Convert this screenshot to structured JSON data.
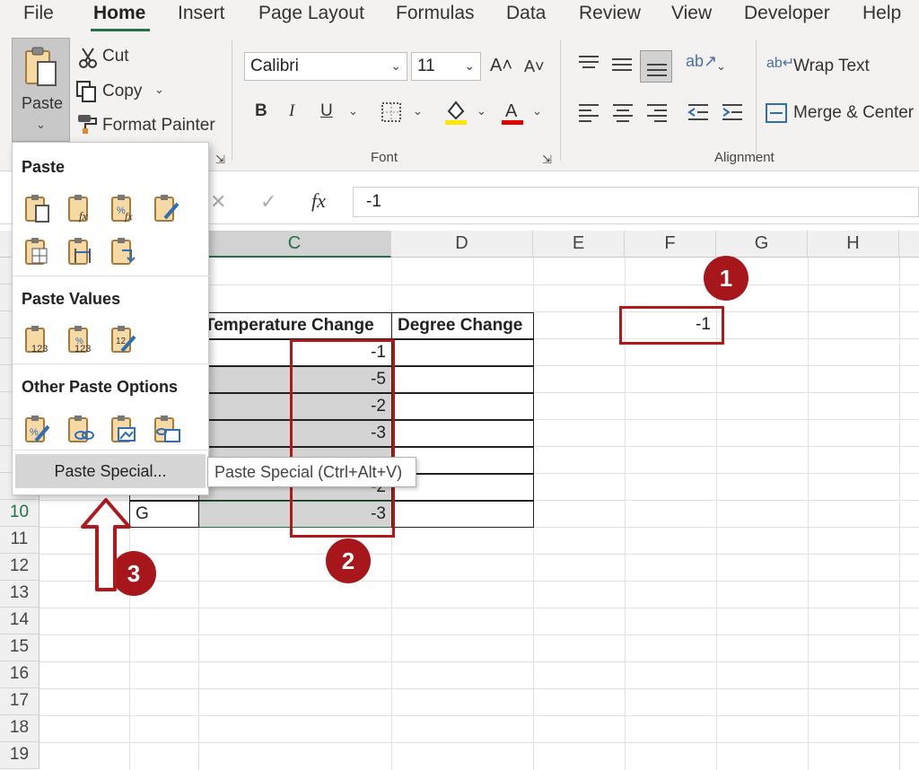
{
  "menu": {
    "tabs": [
      "File",
      "Home",
      "Insert",
      "Page Layout",
      "Formulas",
      "Data",
      "Review",
      "View",
      "Developer",
      "Help"
    ],
    "active": "Home"
  },
  "clipboard": {
    "paste_label": "Paste",
    "cut_label": "Cut",
    "copy_label": "Copy",
    "format_painter_label": "Format Painter"
  },
  "font": {
    "name": "Calibri",
    "size": "11",
    "group_label": "Font",
    "bold": "B",
    "italic": "I",
    "underline": "U",
    "font_color": "#e00000",
    "highlight_color": "#ffe600"
  },
  "alignment": {
    "wrap_text_label": "Wrap Text",
    "merge_center_label": "Merge & Center",
    "group_label": "Alignment"
  },
  "formula_bar": {
    "fx": "fx",
    "value": "-1"
  },
  "columns": [
    "C",
    "D",
    "E",
    "F",
    "G",
    "H"
  ],
  "rows": [
    "10",
    "11",
    "12",
    "13",
    "14",
    "15",
    "16",
    "17",
    "18",
    "19"
  ],
  "sheet": {
    "header_c": "Temperature Change",
    "header_d": "Degree Change",
    "c_values": [
      "-1",
      "-5",
      "-2",
      "-3",
      "-2",
      "-3"
    ],
    "b10": "G",
    "f3": "-1"
  },
  "paste_menu": {
    "paste_heading": "Paste",
    "values_heading": "Paste Values",
    "other_heading": "Other Paste Options",
    "special_label": "Paste Special..."
  },
  "tooltip": "Paste Special (Ctrl+Alt+V)",
  "annotations": {
    "badge1": "1",
    "badge2": "2",
    "badge3": "3",
    "color": "#b0181c"
  }
}
